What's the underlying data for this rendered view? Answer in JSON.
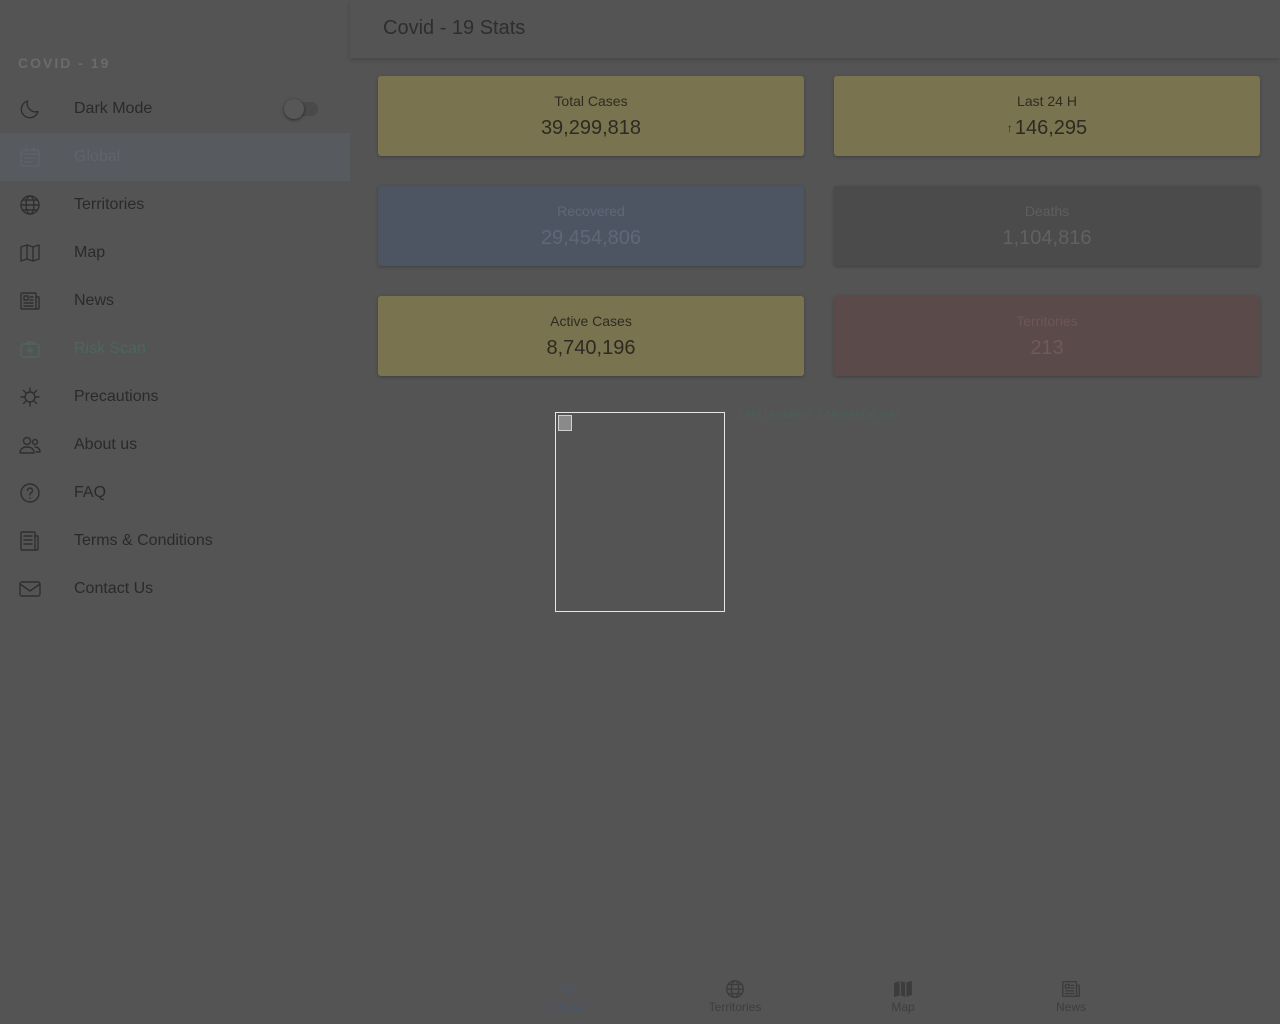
{
  "sidebar": {
    "brand": "COVID - 19",
    "items": [
      {
        "label": "Dark Mode",
        "icon": "moon-icon"
      },
      {
        "label": "Global",
        "icon": "calendar-icon"
      },
      {
        "label": "Territories",
        "icon": "globe-icon"
      },
      {
        "label": "Map",
        "icon": "map-icon"
      },
      {
        "label": "News",
        "icon": "newspaper-icon"
      },
      {
        "label": "Risk Scan",
        "icon": "medkit-icon"
      },
      {
        "label": "Precautions",
        "icon": "virus-icon"
      },
      {
        "label": "About us",
        "icon": "people-icon"
      },
      {
        "label": "FAQ",
        "icon": "help-icon"
      },
      {
        "label": "Terms & Conditions",
        "icon": "document-icon"
      },
      {
        "label": "Contact Us",
        "icon": "mail-icon"
      }
    ],
    "dark_mode_on": false
  },
  "header": {
    "title": "Covid - 19 Stats"
  },
  "stats": {
    "total_cases": {
      "label": "Total Cases",
      "value": "39,299,818"
    },
    "last_24h": {
      "label": "Last 24 H",
      "value": "146,295",
      "arrow": "↑"
    },
    "recovered": {
      "label": "Recovered",
      "value": "29,454,806"
    },
    "deaths": {
      "label": "Deaths",
      "value": "1,104,816"
    },
    "active_cases": {
      "label": "Active Cases",
      "value": "8,740,196"
    },
    "territories": {
      "label": "Territories",
      "value": "213"
    }
  },
  "last_updated": "Last Updated: 3 Minute(s) ago",
  "bottom_nav": [
    {
      "label": "Global",
      "icon": "pulse-icon"
    },
    {
      "label": "Territories",
      "icon": "globe-icon"
    },
    {
      "label": "Map",
      "icon": "map-icon"
    },
    {
      "label": "News",
      "icon": "newspaper-icon"
    }
  ],
  "colors": {
    "overlay_bg": "#545454",
    "yellow_card": "#7a734f",
    "blue_card": "#4d5563",
    "grey_card": "#4b4b4b",
    "red_card": "#5a4a4a",
    "active_item_bg": "#575a5f"
  }
}
